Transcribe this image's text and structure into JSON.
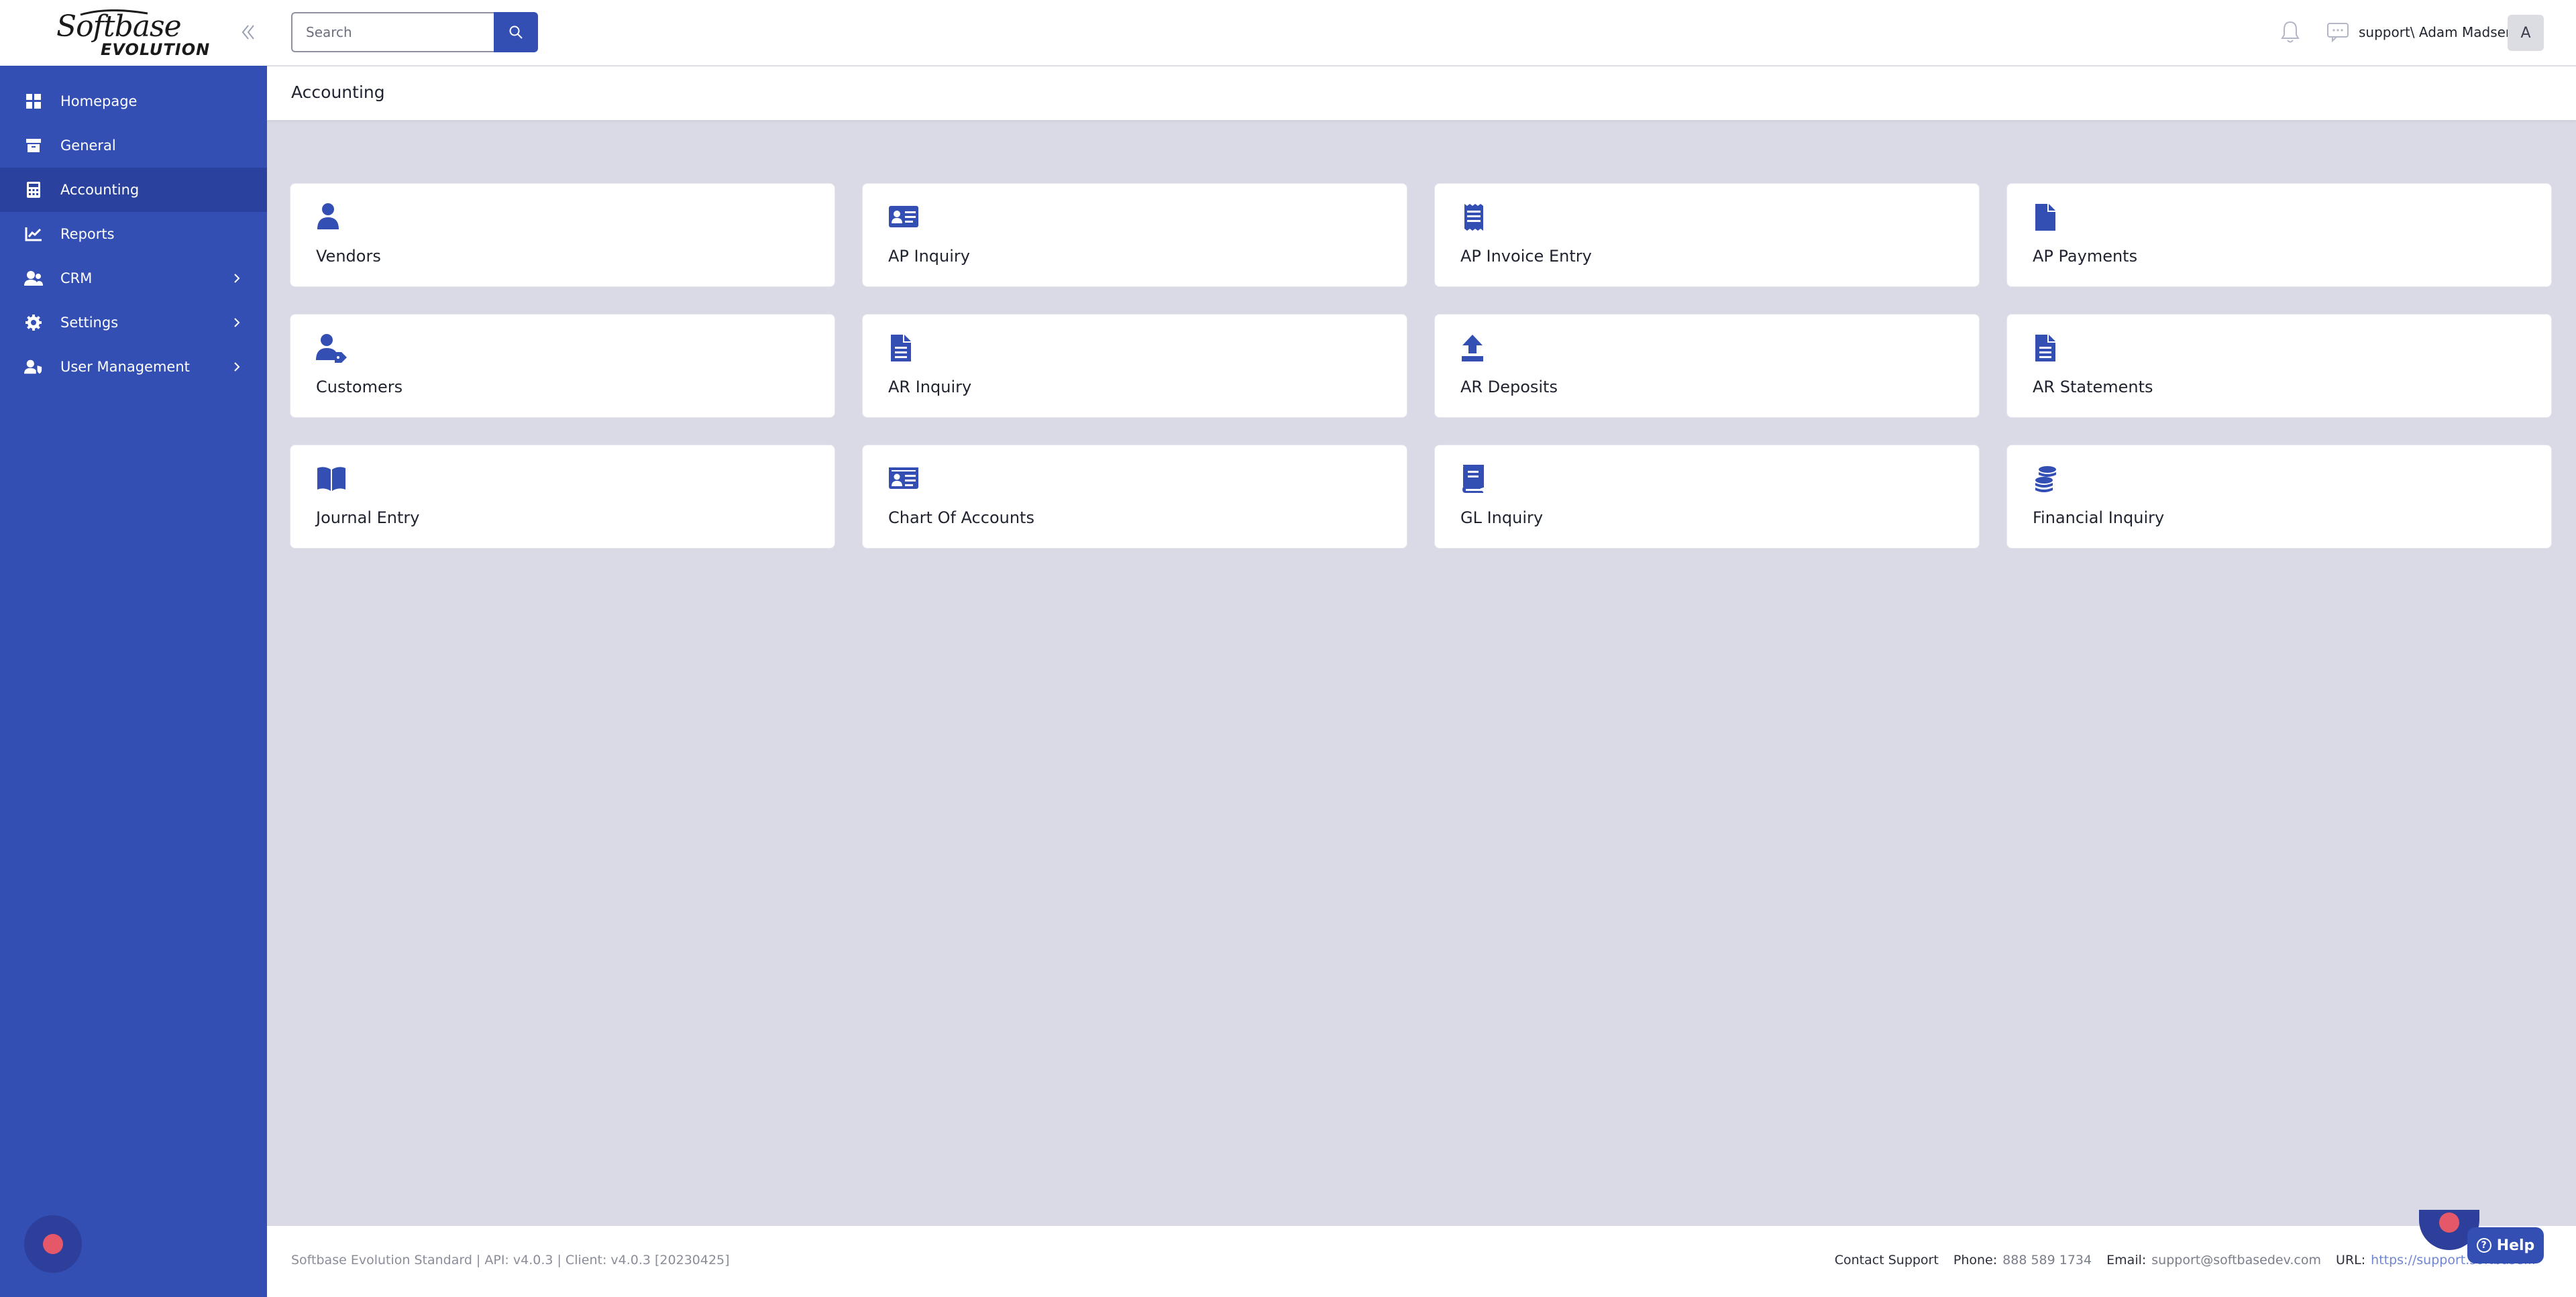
{
  "logo": {
    "main": "Softbase",
    "sub": "EVOLUTION"
  },
  "sidebar": {
    "items": [
      {
        "label": "Homepage",
        "icon": "grid-icon"
      },
      {
        "label": "General",
        "icon": "archive-icon"
      },
      {
        "label": "Accounting",
        "icon": "calculator-icon",
        "active": true
      },
      {
        "label": "Reports",
        "icon": "chart-line-icon"
      },
      {
        "label": "CRM",
        "icon": "users-icon",
        "has_submenu": true
      },
      {
        "label": "Settings",
        "icon": "gear-icon",
        "has_submenu": true
      },
      {
        "label": "User Management",
        "icon": "user-shield-icon",
        "has_submenu": true
      }
    ]
  },
  "topbar": {
    "search_placeholder": "Search",
    "username": "support\\ Adam Madsen",
    "avatar_initial": "A"
  },
  "page": {
    "title": "Accounting"
  },
  "tiles": [
    {
      "label": "Vendors",
      "icon": "user-icon"
    },
    {
      "label": "AP Inquiry",
      "icon": "id-card-icon"
    },
    {
      "label": "AP Invoice Entry",
      "icon": "receipt-icon"
    },
    {
      "label": "AP Payments",
      "icon": "file-icon"
    },
    {
      "label": "Customers",
      "icon": "user-tag-icon"
    },
    {
      "label": "AR Inquiry",
      "icon": "file-alt-icon"
    },
    {
      "label": "AR Deposits",
      "icon": "upload-icon"
    },
    {
      "label": "AR Statements",
      "icon": "file-alt-icon"
    },
    {
      "label": "Journal Entry",
      "icon": "book-open-icon"
    },
    {
      "label": "Chart Of Accounts",
      "icon": "id-card-icon"
    },
    {
      "label": "GL Inquiry",
      "icon": "book-icon"
    },
    {
      "label": "Financial Inquiry",
      "icon": "coins-icon"
    }
  ],
  "footer": {
    "version": "Softbase Evolution Standard | API: v4.0.3 | Client: v4.0.3 [20230425]",
    "contact_label": "Contact Support",
    "phone_label": "Phone:",
    "phone": "888 589 1734",
    "email_label": "Email:",
    "email": "support@softbasedev.com",
    "url_label": "URL:",
    "url": "https://support.softbase..."
  },
  "help": {
    "label": "Help"
  },
  "colors": {
    "accent": "#334fb4",
    "sidebar_active": "#2a429e",
    "background": "#d9dae6",
    "record": "#e5586a"
  }
}
